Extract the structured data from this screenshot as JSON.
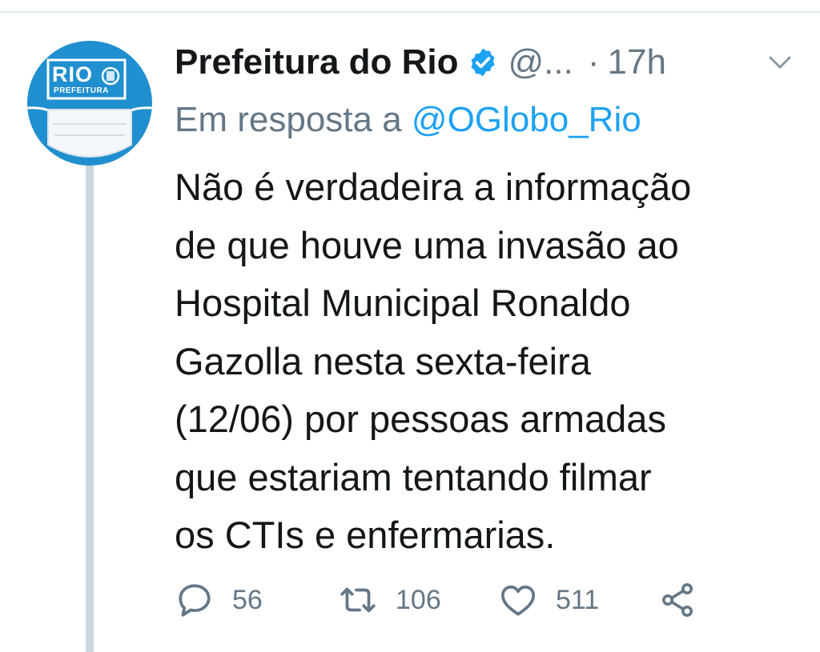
{
  "tweet": {
    "author_name": "Prefeitura do Rio",
    "handle": "@...",
    "separator": "·",
    "time": "17h",
    "reply_prefix": "Em resposta a ",
    "reply_mention": "@OGlobo_Rio",
    "text": "Não é verdadeira a informação\nde que houve uma invasão ao\nHospital Municipal Ronaldo\nGazolla nesta sexta-feira\n(12/06) por pessoas armadas\nque estariam tentando filmar\nos CTIs e enfermarias."
  },
  "avatar": {
    "title": "RIO",
    "subtitle": "PREFEITURA"
  },
  "actions": {
    "reply_count": "56",
    "retweet_count": "106",
    "like_count": "511"
  },
  "colors": {
    "verified": "#1da1f2",
    "mention": "#1da1f2",
    "muted_text": "#657786",
    "avatar_bg": "#1f8fcf",
    "thread_line": "#ccd6dd"
  },
  "icons": {
    "avatar": "prefeitura-rio-logo",
    "verified": "verified-badge-icon",
    "caret": "chevron-down-icon",
    "reply": "reply-bubble-icon",
    "retweet": "retweet-icon",
    "like": "heart-icon",
    "share": "share-icon"
  }
}
